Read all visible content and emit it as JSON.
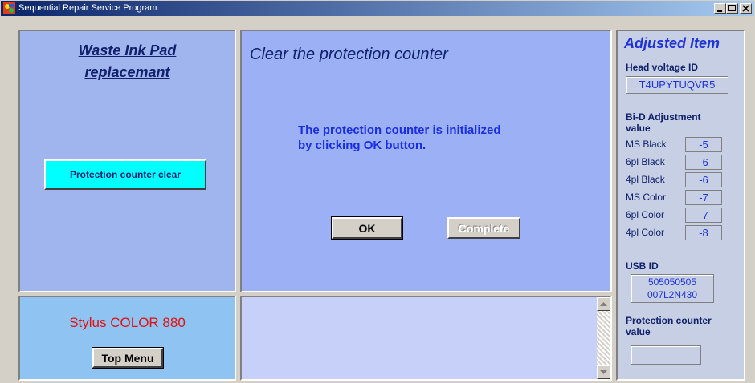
{
  "window": {
    "title": "Sequential Repair Service Program",
    "accent": "#0a246a"
  },
  "left": {
    "title_line1": "Waste Ink Pad",
    "title_line2": "replacemant",
    "clear_button": "Protection counter clear"
  },
  "center": {
    "title": "Clear the protection counter",
    "message_line1": "The protection counter is initialized",
    "message_line2": "by clicking OK button.",
    "ok_button": "OK",
    "complete_button": "Complete"
  },
  "bottom_left": {
    "model": "Stylus COLOR 880",
    "top_menu_button": "Top Menu"
  },
  "right": {
    "title": "Adjusted Item",
    "head_voltage_label": "Head voltage ID",
    "head_voltage_value": "T4UPYTUQVR5",
    "bid_label_line1": "Bi-D Adjustment",
    "bid_label_line2": "value",
    "bid_items": [
      {
        "label": "MS Black",
        "value": "-5"
      },
      {
        "label": "6pl Black",
        "value": "-6"
      },
      {
        "label": "4pl Black",
        "value": "-6"
      },
      {
        "label": "MS Color",
        "value": "-7"
      },
      {
        "label": "6pl Color",
        "value": "-7"
      },
      {
        "label": "4pl Color",
        "value": "-8"
      }
    ],
    "usb_label": "USB ID",
    "usb_value_line1": "505050505",
    "usb_value_line2": "007L2N430",
    "protection_label_line1": "Protection counter",
    "protection_label_line2": "value",
    "protection_value": ""
  },
  "colors": {
    "model_text": "#e01010",
    "value_text": "#1f33d6",
    "clear_button_bg": "#00ffff"
  }
}
